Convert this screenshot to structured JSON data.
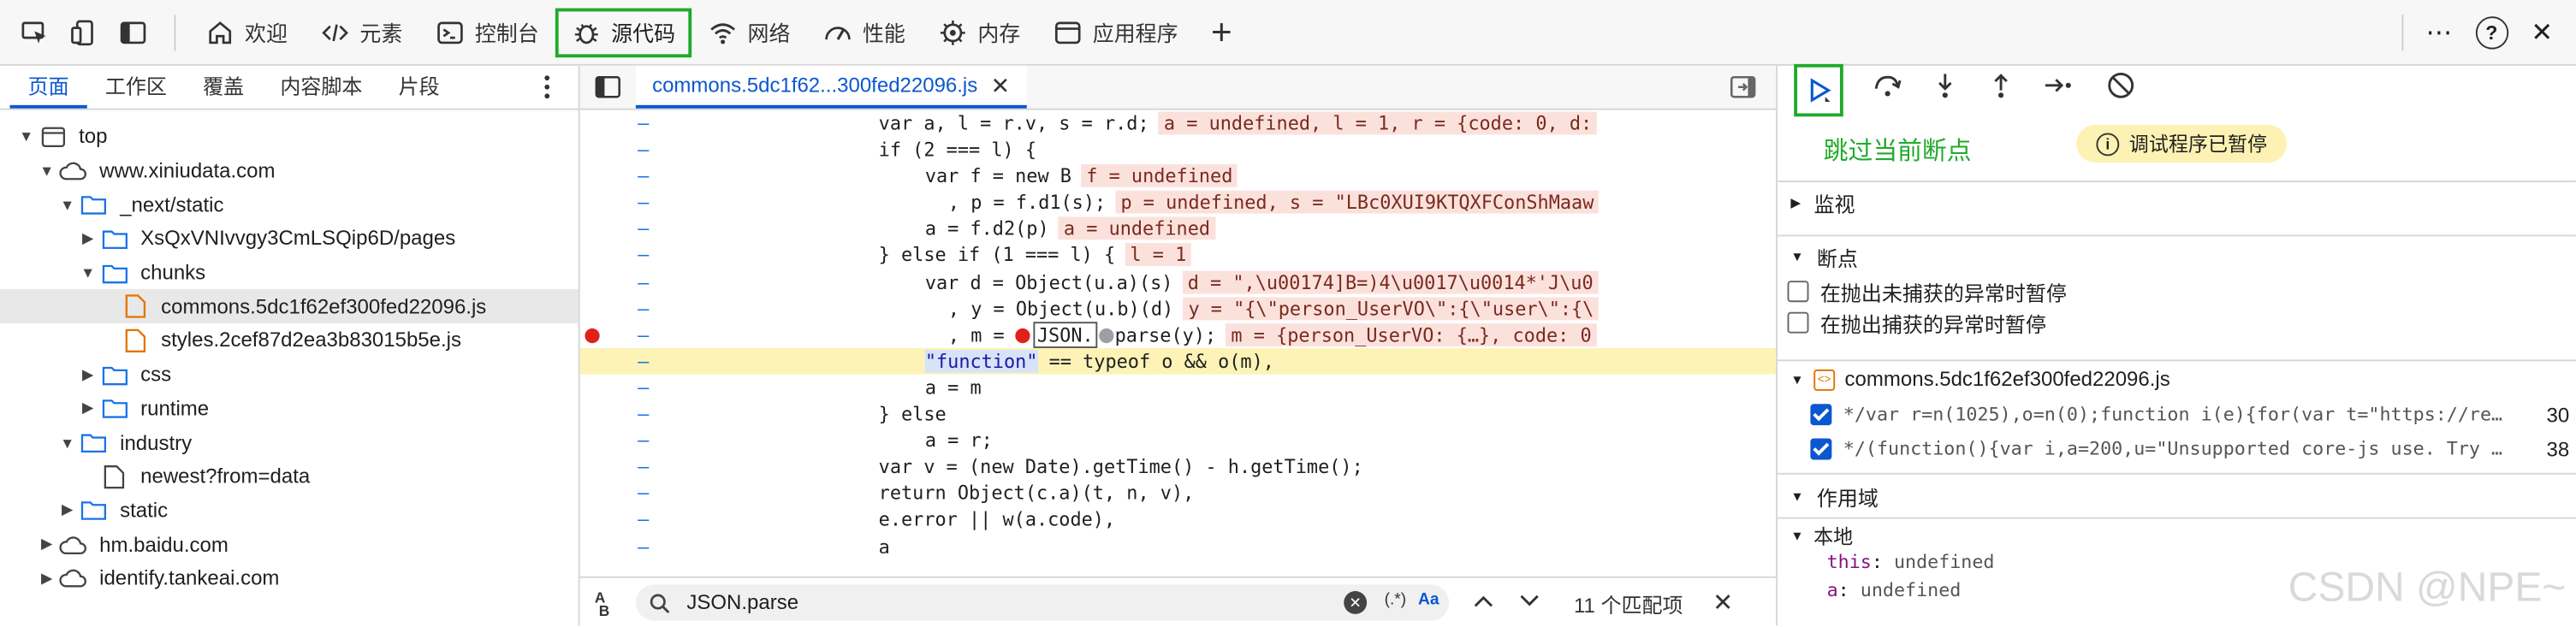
{
  "toolbar": {
    "tabs": [
      {
        "label": "欢迎",
        "icon": "home-icon"
      },
      {
        "label": "元素",
        "icon": "code-brackets-icon"
      },
      {
        "label": "控制台",
        "icon": "console-icon"
      },
      {
        "label": "源代码",
        "icon": "bug-icon"
      },
      {
        "label": "网络",
        "icon": "wifi-icon"
      },
      {
        "label": "性能",
        "icon": "performance-icon"
      },
      {
        "label": "内存",
        "icon": "memory-icon"
      },
      {
        "label": "应用程序",
        "icon": "application-icon"
      }
    ],
    "add_tab": "+",
    "help": "?",
    "more": "⋯",
    "close": "✕"
  },
  "navigator": {
    "tabs": [
      "页面",
      "工作区",
      "覆盖",
      "内容脚本",
      "片段"
    ],
    "tree": [
      {
        "label": "top",
        "indent": 0,
        "arrow": "down",
        "icon": "frame"
      },
      {
        "label": "www.xiniudata.com",
        "indent": 1,
        "arrow": "down",
        "icon": "cloud"
      },
      {
        "label": "_next/static",
        "indent": 2,
        "arrow": "down",
        "icon": "folder"
      },
      {
        "label": "XsQxVNIvvgy3CmLSQip6D/pages",
        "indent": 3,
        "arrow": "right",
        "icon": "folder"
      },
      {
        "label": "chunks",
        "indent": 3,
        "arrow": "down",
        "icon": "folder"
      },
      {
        "label": "commons.5dc1f62ef300fed22096.js",
        "indent": 4,
        "arrow": "none",
        "icon": "file-js",
        "selected": true
      },
      {
        "label": "styles.2cef87d2ea3b83015b5e.js",
        "indent": 4,
        "arrow": "none",
        "icon": "file-js"
      },
      {
        "label": "css",
        "indent": 3,
        "arrow": "right",
        "icon": "folder"
      },
      {
        "label": "runtime",
        "indent": 3,
        "arrow": "right",
        "icon": "folder"
      },
      {
        "label": "industry",
        "indent": 2,
        "arrow": "down",
        "icon": "folder"
      },
      {
        "label": "newest?from=data",
        "indent": 3,
        "arrow": "none",
        "icon": "file"
      },
      {
        "label": "static",
        "indent": 2,
        "arrow": "right",
        "icon": "folder"
      },
      {
        "label": "hm.baidu.com",
        "indent": 1,
        "arrow": "right",
        "icon": "cloud"
      },
      {
        "label": "identify.tankeai.com",
        "indent": 1,
        "arrow": "right",
        "icon": "cloud"
      }
    ]
  },
  "editor": {
    "file_tab": "commons.5dc1f62...300fed22096.js",
    "lines": [
      {
        "indent": 17,
        "code": "var a, l = r.v, s = r.d;",
        "inline": "a = undefined, l = 1, r = {code: 0, d:"
      },
      {
        "indent": 17,
        "code": "if (2 === l) {",
        "inline": ""
      },
      {
        "indent": 21,
        "code": "var f = new B",
        "inline": "f = undefined"
      },
      {
        "indent": 23,
        "code": ", p = f.d1(s);",
        "inline": "p = undefined, s = \"LBc0XUI9KTQXFConShMaaw"
      },
      {
        "indent": 21,
        "code": "a = f.d2(p)",
        "inline": "a = undefined"
      },
      {
        "indent": 17,
        "code": "} else if (1 === l) {",
        "inline": "l = 1"
      },
      {
        "indent": 21,
        "code": "var d = Object(u.a)(s)",
        "inline": "d = \",\\u00174]B=)4\\u0017\\u0014*'J\\u0"
      },
      {
        "indent": 23,
        "code": ", y = Object(u.b)(d)",
        "inline": "y = \"{\\\"person_UserVO\\\":{\\\"user\\\":{\\"
      },
      {
        "indent": 23,
        "code": ", m = ",
        "code_tail": "JSON.parse(y);",
        "inline": "m = {person_UserVO: {…}, code: 0",
        "breakpoint": true
      },
      {
        "indent": 21,
        "code": "\"function\" == typeof o && o(m),",
        "inline": "",
        "current": true
      },
      {
        "indent": 21,
        "code": "a = m",
        "inline": ""
      },
      {
        "indent": 17,
        "code": "} else",
        "inline": ""
      },
      {
        "indent": 21,
        "code": "a = r;",
        "inline": ""
      },
      {
        "indent": 17,
        "code": "var v = (new Date).getTime() - h.getTime();",
        "inline": ""
      },
      {
        "indent": 17,
        "code": "return Object(c.a)(t, n, v),",
        "inline": ""
      },
      {
        "indent": 17,
        "code": "e.error || w(a.code),",
        "inline": ""
      },
      {
        "indent": 17,
        "code": "a",
        "inline": ""
      }
    ],
    "search": {
      "value": "JSON.parse",
      "regex_label": "(.*)",
      "case_label": "Aa",
      "count": "11 个匹配项"
    }
  },
  "debugger": {
    "hint": "跳过当前断点",
    "paused": "调试程序已暂停",
    "sections": {
      "watch": "监视",
      "breakpoints": "断点",
      "scope": "作用域"
    },
    "exception_options": [
      "在抛出未捕获的异常时暂停",
      "在抛出捕获的异常时暂停"
    ],
    "bp_file": "commons.5dc1f62ef300fed22096.js",
    "bp_list": [
      {
        "code": "*/var r=n(1025),o=n(0);function i(e){for(var t=\"https://re…",
        "line": "30",
        "checked": true
      },
      {
        "code": "*/(function(){var i,a=200,u=\"Unsupported core-js use. Try …",
        "line": "38",
        "checked": true
      }
    ],
    "scope_local": "本地",
    "scope_vars": [
      {
        "name": "this",
        "value": "undefined"
      },
      {
        "name": "a",
        "value": "undefined"
      }
    ]
  },
  "watermark": "CSDN @NPE~"
}
